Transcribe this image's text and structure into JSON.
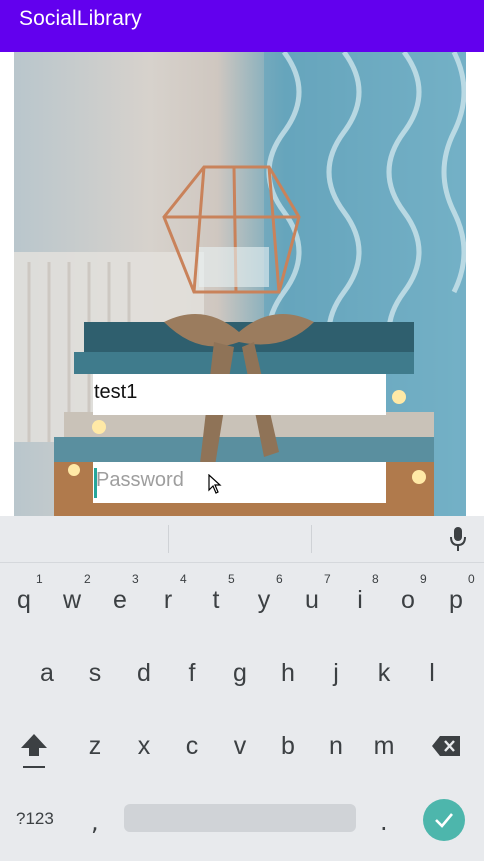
{
  "app": {
    "title": "SocialLibrary"
  },
  "login": {
    "username_value": "test1",
    "password_placeholder": "Password"
  },
  "keyboard": {
    "row1": [
      {
        "letter": "q",
        "num": "1"
      },
      {
        "letter": "w",
        "num": "2"
      },
      {
        "letter": "e",
        "num": "3"
      },
      {
        "letter": "r",
        "num": "4"
      },
      {
        "letter": "t",
        "num": "5"
      },
      {
        "letter": "y",
        "num": "6"
      },
      {
        "letter": "u",
        "num": "7"
      },
      {
        "letter": "i",
        "num": "8"
      },
      {
        "letter": "o",
        "num": "9"
      },
      {
        "letter": "p",
        "num": "0"
      }
    ],
    "row2": [
      "a",
      "s",
      "d",
      "f",
      "g",
      "h",
      "j",
      "k",
      "l"
    ],
    "row3": [
      "z",
      "x",
      "c",
      "v",
      "b",
      "n",
      "m"
    ],
    "symbols_label": "?123",
    "comma": ",",
    "period": ".",
    "icons": {
      "mic": "mic-icon",
      "shift": "shift-icon",
      "backspace": "backspace-icon",
      "enter": "check-icon"
    }
  },
  "colors": {
    "appbar": "#6200ee",
    "accent": "#26a69a",
    "enter": "#4db6ac",
    "keyboard_bg": "#e8eaed"
  }
}
